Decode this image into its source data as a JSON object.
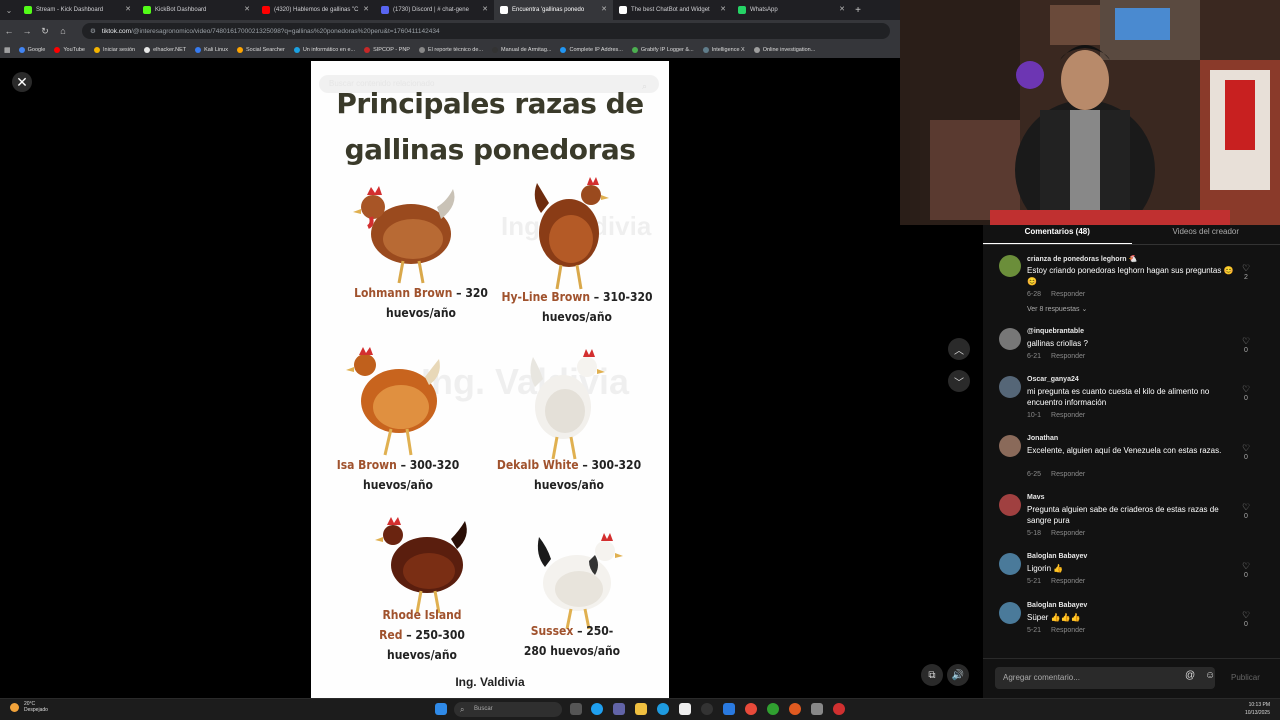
{
  "browser": {
    "tabs": [
      {
        "label": "Stream - Kick Dashboard",
        "color": "#53fc18"
      },
      {
        "label": "KickBot Dashboard",
        "color": "#53fc18"
      },
      {
        "label": "(4320) Hablemos de gallinas \"C",
        "color": "#ff0000"
      },
      {
        "label": "(1730) Discord | # chat-gene",
        "color": "#5865f2"
      },
      {
        "label": "Encuentra 'gallinas ponedo",
        "color": "#ffffff",
        "active": true
      },
      {
        "label": "The best ChatBot and Widget",
        "color": "#ffffff"
      },
      {
        "label": "WhatsApp",
        "color": "#25d366"
      }
    ],
    "url_domain": "tiktok.com",
    "url_path": "/@interesagronomico/video/7480161700021325098?q=gallinas%20ponedoras%20peru&t=1760411142434",
    "bookmarks": [
      {
        "label": "Google",
        "color": "#4285f4"
      },
      {
        "label": "YouTube",
        "color": "#ff0000"
      },
      {
        "label": "Iniciar sesión",
        "color": "#f4b400"
      },
      {
        "label": "elhacker.NET",
        "color": "#e8e8e8"
      },
      {
        "label": "Kali Linux",
        "color": "#367bf0"
      },
      {
        "label": "Social Searcher",
        "color": "#ffa500"
      },
      {
        "label": "Un informático en e...",
        "color": "#1ba1e2"
      },
      {
        "label": "SIPCOP - PNP",
        "color": "#c62828"
      },
      {
        "label": "El reporte técnico de...",
        "color": "#888888"
      },
      {
        "label": "Manual de Armitag...",
        "color": "#333333"
      },
      {
        "label": "Complete IP Addres...",
        "color": "#2196f3"
      },
      {
        "label": "Grabify IP Logger &...",
        "color": "#4caf50"
      },
      {
        "label": "Intelligence X",
        "color": "#607d8b"
      },
      {
        "label": "Online investigation...",
        "color": "#9e9e9e"
      }
    ]
  },
  "video": {
    "search_placeholder": "Buscar contenido relacionado",
    "title_line1": "Principales razas de",
    "title_line2": "gallinas ponedoras",
    "watermark": "Ing. Valdivia",
    "breeds": [
      {
        "name": "Lohmann Brown",
        "dash": " – ",
        "count": "320",
        "unit": "huevos/año"
      },
      {
        "name": "Hy-Line Brown",
        "dash": " – ",
        "count": "310-320",
        "unit": "huevos/año"
      },
      {
        "name": "Isa Brown",
        "dash": " – ",
        "count": "300-320",
        "unit": "huevos/año"
      },
      {
        "name": "Dekalb White",
        "dash": " – ",
        "count": "300-320",
        "unit": "huevos/año"
      },
      {
        "name": "Rhode Island",
        "name2": "Red",
        "dash": " – ",
        "count": "250-300",
        "unit": "huevos/año"
      },
      {
        "name": "Sussex",
        "dash": " – ",
        "count": "250-",
        "count2": "280",
        "unit": "huevos/año"
      }
    ],
    "credit": "Ing. Valdivia"
  },
  "comments_panel": {
    "tab_comments": "Comentarios (48)",
    "tab_creator": "Videos del creador",
    "reply_label": "Responder",
    "comments": [
      {
        "user": "crianza de ponedoras leghorn 🐔",
        "text": "Estoy criando ponedoras leghorn hagan sus preguntas 😊😊",
        "date": "6-28",
        "likes": "2",
        "more": "Ver 8 respuestas ⌄",
        "avatar": "#6b8e3a"
      },
      {
        "user": "@inquebrantable",
        "text": "gallinas criollas ?",
        "date": "6-21",
        "likes": "0",
        "avatar": "#777777"
      },
      {
        "user": "Oscar_ganya24",
        "text": "mi pregunta es cuanto cuesta el kilo de alimento no encuentro información",
        "date": "10-1",
        "likes": "0",
        "avatar": "#556677"
      },
      {
        "user": "Jonathan",
        "text": "Excelente, alguien aquí de Venezuela con estas razas.",
        "date": "6-25",
        "likes": "0",
        "avatar": "#8a6a5a"
      },
      {
        "user": "Mavs",
        "text": "Pregunta alguien sabe de criaderos de estas razas de sangre pura",
        "date": "5-18",
        "likes": "0",
        "avatar": "#a04040"
      },
      {
        "user": "Baloglan Babayev",
        "text": "Ligorin 👍",
        "date": "5-21",
        "likes": "0",
        "avatar": "#4a7a9a"
      },
      {
        "user": "Baloglan Babayev",
        "text": "Süper 👍👍👍",
        "date": "5-21",
        "likes": "0",
        "avatar": "#4a7a9a"
      }
    ],
    "input_placeholder": "Agregar comentario...",
    "publish_label": "Publicar"
  },
  "taskbar": {
    "temp": "20°C",
    "weather": "Despejado",
    "search_placeholder": "Buscar",
    "time": "10:13 PM",
    "date": "10/13/2025"
  }
}
